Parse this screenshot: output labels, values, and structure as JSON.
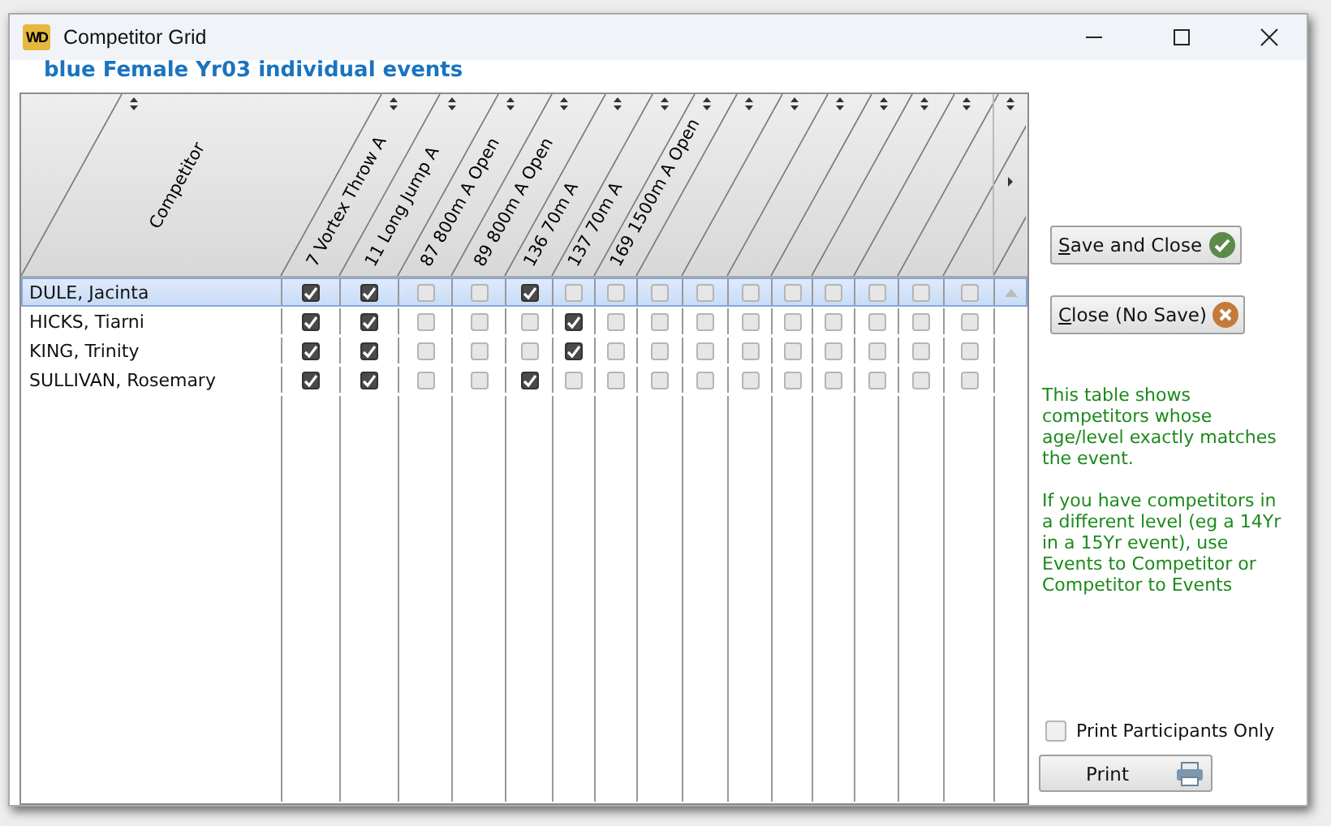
{
  "window": {
    "app_icon": "WD",
    "title": "Competitor Grid"
  },
  "heading": "blue Female Yr03 individual events",
  "table": {
    "competitor_column": "Competitor",
    "event_columns": [
      "7 Vortex Throw A",
      "11 Long Jump A",
      "87 800m A Open",
      "89 800m A Open",
      "136 70m A",
      "137 70m A",
      "169 1500m A Open",
      "",
      "",
      "",
      "",
      "",
      "",
      "",
      ""
    ],
    "rows": [
      {
        "name": "DULE, Jacinta",
        "selected": true,
        "cells": [
          {
            "checked": true
          },
          {
            "checked": true
          },
          {
            "checked": false
          },
          {
            "checked": false
          },
          {
            "checked": true
          },
          {
            "checked": false
          },
          {
            "checked": false
          },
          {
            "checked": false
          },
          {
            "checked": false
          },
          {
            "checked": false
          },
          {
            "checked": false
          },
          {
            "checked": false
          },
          {
            "checked": false
          },
          {
            "checked": false
          },
          {
            "checked": false
          }
        ]
      },
      {
        "name": "HICKS, Tiarni",
        "selected": false,
        "cells": [
          {
            "checked": true
          },
          {
            "checked": true
          },
          {
            "checked": false
          },
          {
            "checked": false
          },
          {
            "checked": false
          },
          {
            "checked": true
          },
          {
            "checked": false
          },
          {
            "checked": false
          },
          {
            "checked": false
          },
          {
            "checked": false
          },
          {
            "checked": false
          },
          {
            "checked": false
          },
          {
            "checked": false
          },
          {
            "checked": false
          },
          {
            "checked": false
          }
        ]
      },
      {
        "name": "KING, Trinity",
        "selected": false,
        "cells": [
          {
            "checked": true
          },
          {
            "checked": true
          },
          {
            "checked": false
          },
          {
            "checked": false
          },
          {
            "checked": false
          },
          {
            "checked": true
          },
          {
            "checked": false
          },
          {
            "checked": false
          },
          {
            "checked": false
          },
          {
            "checked": false
          },
          {
            "checked": false
          },
          {
            "checked": false
          },
          {
            "checked": false
          },
          {
            "checked": false
          },
          {
            "checked": false
          }
        ]
      },
      {
        "name": "SULLIVAN, Rosemary",
        "selected": false,
        "cells": [
          {
            "checked": true
          },
          {
            "checked": true
          },
          {
            "checked": false
          },
          {
            "checked": false
          },
          {
            "checked": true
          },
          {
            "checked": false
          },
          {
            "checked": false
          },
          {
            "checked": false
          },
          {
            "checked": false
          },
          {
            "checked": false
          },
          {
            "checked": false
          },
          {
            "checked": false
          },
          {
            "checked": false
          },
          {
            "checked": false
          },
          {
            "checked": false
          }
        ]
      }
    ]
  },
  "buttons": [
    {
      "label": "Save and Close",
      "kind": "save"
    },
    {
      "label": "Close (No Save)",
      "kind": "cancel"
    }
  ],
  "help_text": [
    "This table shows competitors whose age/level exactly matches the event.",
    "If you have competitors in a different level (eg a 14Yr in a 15Yr event), use Events to Competitor or Competitor to Events"
  ],
  "print_participants_only": {
    "label": "Print Participants Only",
    "checked": false
  },
  "print_button": "Print"
}
